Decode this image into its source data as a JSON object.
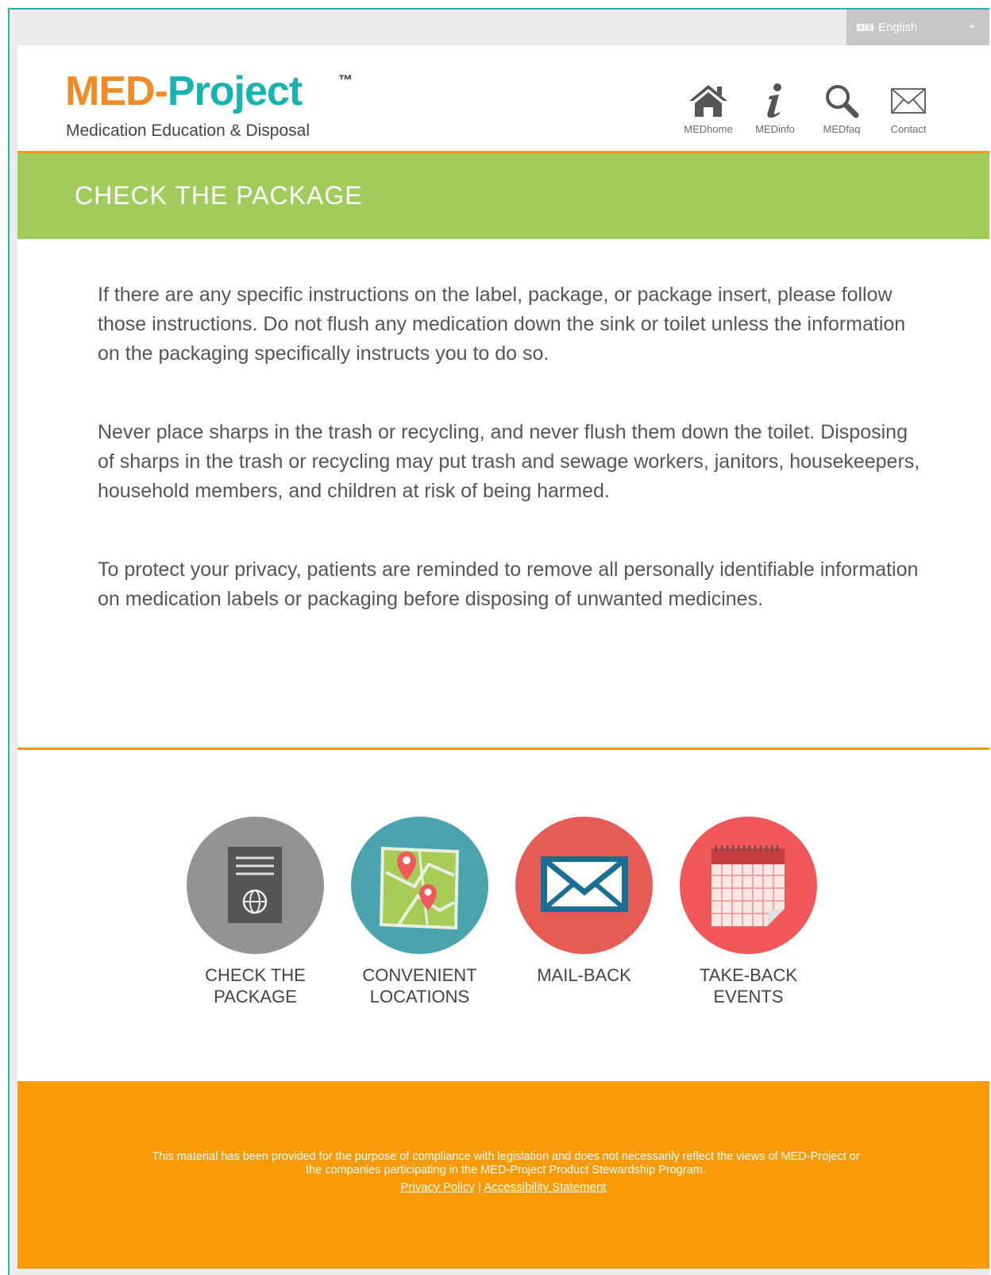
{
  "language": {
    "selected": "English",
    "icon": "translate-icon"
  },
  "header": {
    "logo_part1": "MED-",
    "logo_part2": "Project",
    "logo_tm": "™",
    "logo_sub": "Medication Education & Disposal",
    "nav": [
      {
        "label": "MEDhome",
        "icon": "home-icon"
      },
      {
        "label": "MEDinfo",
        "icon": "info-icon"
      },
      {
        "label": "MEDfaq",
        "icon": "search-icon"
      },
      {
        "label": "Contact",
        "icon": "envelope-icon"
      }
    ]
  },
  "banner": {
    "title": "CHECK THE PACKAGE"
  },
  "content": {
    "paragraphs": [
      "If there are any specific instructions on the label, package, or package insert, please follow those instructions. Do not flush any medication down the sink or toilet unless the information on the packaging specifically instructs you to do so.",
      "Never place sharps in the trash or recycling, and never flush them down the toilet. Disposing of sharps in the trash or recycling may put trash and sewage workers, janitors, housekeepers, household members, and children at risk of being harmed.",
      "To protect your privacy, patients are reminded to remove all personally identifiable information on medication labels or packaging before disposing of unwanted medicines."
    ]
  },
  "options": [
    {
      "line1": "CHECK THE",
      "line2": "PACKAGE",
      "icon": "package-icon",
      "color": "#939393"
    },
    {
      "line1": "CONVENIENT",
      "line2": "LOCATIONS",
      "icon": "map-icon",
      "color": "#4ba3b0"
    },
    {
      "line1": "MAIL-BACK",
      "line2": "",
      "icon": "mail-icon",
      "color": "#e65c55"
    },
    {
      "line1": "TAKE-BACK",
      "line2": "EVENTS",
      "icon": "calendar-icon",
      "color": "#ef5758"
    }
  ],
  "footer": {
    "disclaimer": "This material has been provided for the purpose of compliance with legislation and does not necessarily reflect the views of MED-Project or the companies participating in the MED-Project Product Stewardship Program.",
    "privacy_link": "Privacy Policy",
    "separator": "|",
    "accessibility_link": "Accessibility Statement"
  },
  "colors": {
    "accent_orange": "#f7941d",
    "banner_green": "#a0cc5c",
    "teal": "#17b3b0",
    "footer": "#f99b07"
  }
}
